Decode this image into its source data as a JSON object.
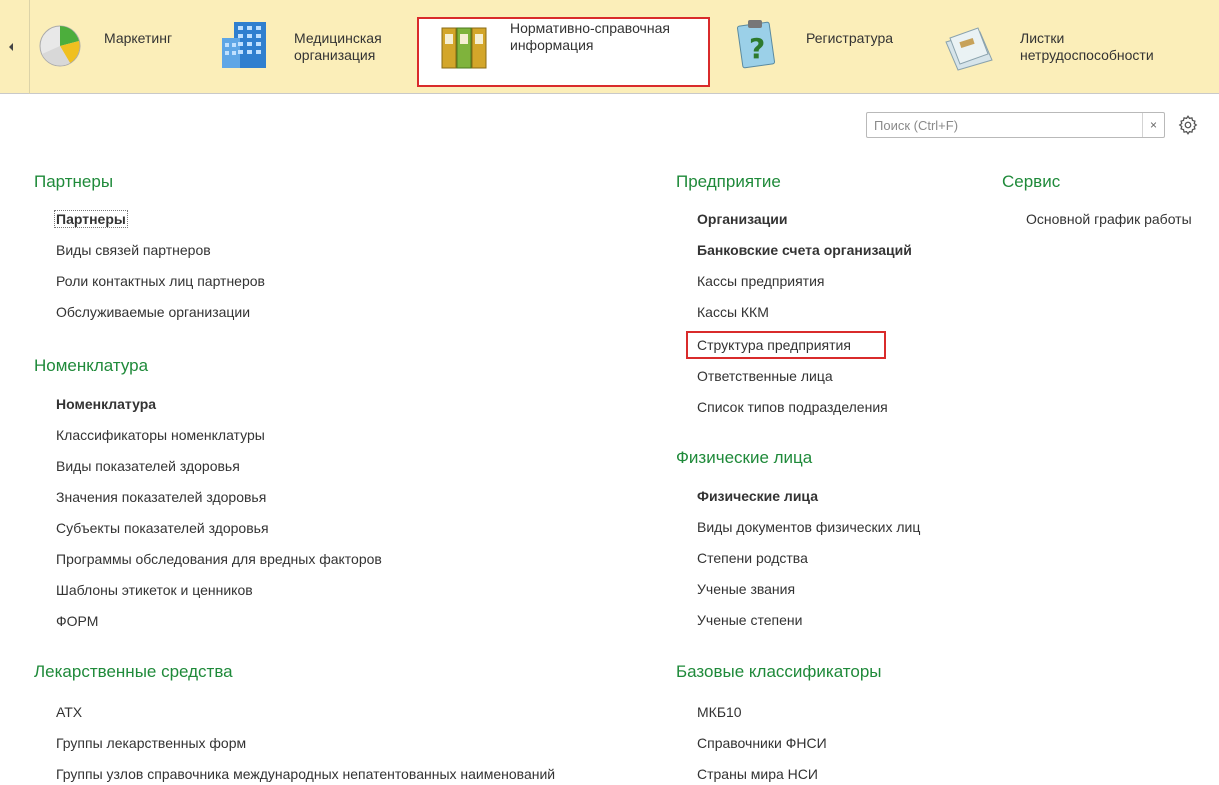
{
  "ribbon": {
    "sections": [
      {
        "label": "Маркетинг",
        "icon": "pie-chart-icon"
      },
      {
        "label": "Медицинская\nорганизация",
        "icon": "building-icon"
      },
      {
        "label": "Нормативно-справочная\nинформация",
        "icon": "binders-icon",
        "active": true
      },
      {
        "label": "Регистратура",
        "icon": "clipboard-question-icon"
      },
      {
        "label": "Листки\nнетрудоспособности",
        "icon": "documents-icon"
      }
    ]
  },
  "search": {
    "placeholder": "Поиск (Ctrl+F)",
    "value": "",
    "clear": "×"
  },
  "colors": {
    "ribbon_bg": "#fbeeb9",
    "group_title": "#1f8a3a",
    "highlight": "#d92b2b"
  },
  "groups": {
    "partners": {
      "title": "Партнеры",
      "items": [
        "Партнеры",
        "Виды связей партнеров",
        "Роли контактных лиц партнеров",
        "Обслуживаемые организации"
      ]
    },
    "nomenclature": {
      "title": "Номенклатура",
      "items": [
        "Номенклатура",
        "Классификаторы номенклатуры",
        "Виды показателей здоровья",
        "Значения показателей здоровья",
        "Субъекты показателей здоровья",
        "Программы обследования для вредных факторов",
        "Шаблоны этикеток и ценников",
        "ФОРМ"
      ]
    },
    "drugs": {
      "title": "Лекарственные средства",
      "items": [
        "АТХ",
        "Группы лекарственных форм",
        "Группы узлов справочника международных непатентованных наименований"
      ]
    },
    "enterprise": {
      "title": "Предприятие",
      "items": [
        "Организации",
        "Банковские счета организаций",
        "Кассы предприятия",
        "Кассы ККМ",
        "Структура предприятия",
        "Ответственные лица",
        "Список типов подразделения"
      ]
    },
    "individuals": {
      "title": "Физические лица",
      "items": [
        "Физические лица",
        "Виды документов физических лиц",
        "Степени родства",
        "Ученые звания",
        "Ученые степени"
      ]
    },
    "base_classifiers": {
      "title": "Базовые классификаторы",
      "items": [
        "МКБ10",
        "Справочники ФНСИ",
        "Страны мира НСИ"
      ]
    },
    "service": {
      "title": "Сервис",
      "items": [
        "Основной график работы"
      ]
    }
  }
}
